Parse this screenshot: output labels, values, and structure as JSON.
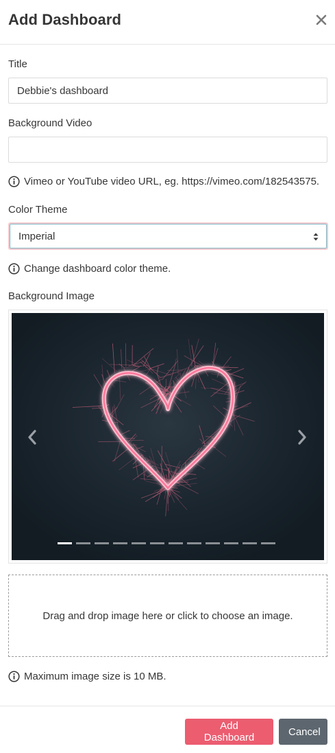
{
  "modal": {
    "title": "Add Dashboard",
    "close_icon": "close-icon"
  },
  "form": {
    "title_label": "Title",
    "title_value": "Debbie's dashboard",
    "video_label": "Background Video",
    "video_value": "",
    "video_help": "Vimeo or YouTube video URL, eg. https://vimeo.com/182543575.",
    "theme_label": "Color Theme",
    "theme_value": "Imperial",
    "theme_help": "Change dashboard color theme.",
    "image_label": "Background Image",
    "dropzone_text": "Drag and drop image here or click to choose an image.",
    "image_help": "Maximum image size is 10 MB."
  },
  "carousel": {
    "slide_count": 12,
    "active_slide": 0,
    "prev_icon": "chevron-left-icon",
    "next_icon": "chevron-right-icon"
  },
  "footer": {
    "submit_label": "Add Dashboard",
    "cancel_label": "Cancel"
  },
  "colors": {
    "primary": "#ec5d70",
    "cancel": "#5d666e",
    "focus_ring": "#f7c9cf",
    "slide_background": "#17212a"
  }
}
